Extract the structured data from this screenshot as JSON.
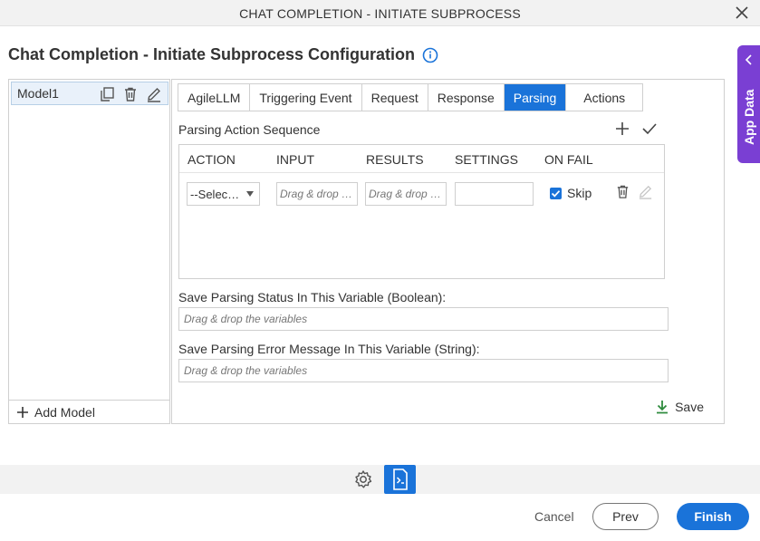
{
  "window": {
    "title": "CHAT COMPLETION - INITIATE SUBPROCESS",
    "close_icon": "close-icon"
  },
  "page": {
    "heading": "Chat Completion - Initiate Subprocess Configuration",
    "info_icon": "info-icon"
  },
  "models": {
    "items": [
      {
        "label": "Model1"
      }
    ],
    "add_label": "Add Model"
  },
  "tabs": [
    {
      "label": "AgileLLM"
    },
    {
      "label": "Triggering Event"
    },
    {
      "label": "Request"
    },
    {
      "label": "Response"
    },
    {
      "label": "Parsing"
    },
    {
      "label": "Actions"
    }
  ],
  "active_tab": "Parsing",
  "parsing": {
    "sequence_label": "Parsing Action Sequence",
    "columns": [
      "ACTION",
      "INPUT",
      "RESULTS",
      "SETTINGS",
      "ON FAIL"
    ],
    "row": {
      "action": "--Selec…",
      "input_placeholder": "Drag & drop …",
      "results_placeholder": "Drag & drop …",
      "settings": "",
      "on_fail_checked": true,
      "on_fail_label": "Skip"
    },
    "status_label": "Save Parsing Status In This Variable (Boolean):",
    "status_placeholder": "Drag & drop the variables",
    "error_label": "Save Parsing Error Message In This Variable (String):",
    "error_placeholder": "Drag & drop the variables",
    "save_label": "Save"
  },
  "side_panel": {
    "label": "App Data"
  },
  "footer": {
    "cancel": "Cancel",
    "prev": "Prev",
    "finish": "Finish"
  },
  "colors": {
    "accent": "#1a73d9",
    "app_data": "#7a3fd3",
    "save_icon": "#2e8b3d"
  }
}
